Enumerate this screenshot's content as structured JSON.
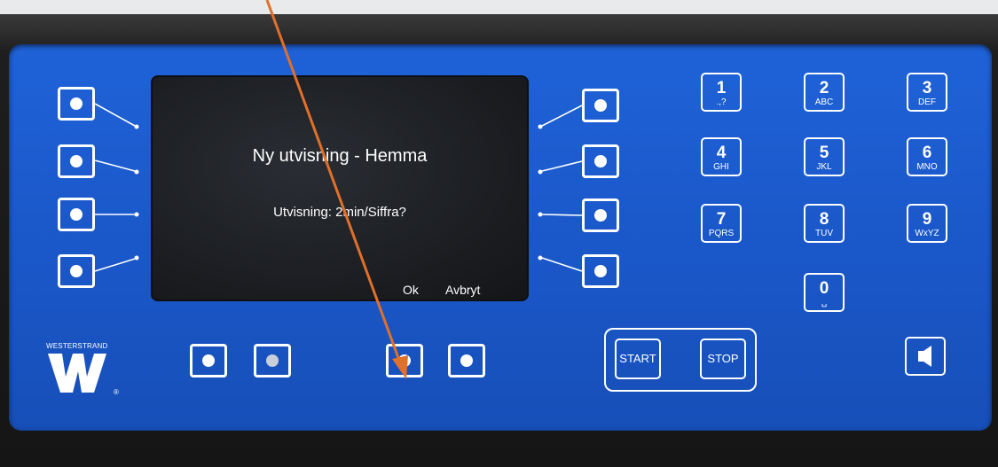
{
  "header_text": "",
  "display": {
    "title": "Ny utvisning - Hemma",
    "prompt": "Utvisning: 2min/Siffra?",
    "soft_ok": "Ok",
    "soft_cancel": "Avbryt"
  },
  "keypad": [
    {
      "num": "1",
      "letters": ".,?"
    },
    {
      "num": "2",
      "letters": "ABC"
    },
    {
      "num": "3",
      "letters": "DEF"
    },
    {
      "num": "4",
      "letters": "GHI"
    },
    {
      "num": "5",
      "letters": "JKL"
    },
    {
      "num": "6",
      "letters": "MNO"
    },
    {
      "num": "7",
      "letters": "PQRS"
    },
    {
      "num": "8",
      "letters": "TUV"
    },
    {
      "num": "9",
      "letters": "WxYZ"
    },
    {
      "num": "0",
      "letters": "␣"
    }
  ],
  "controls": {
    "start": "START",
    "stop": "STOP"
  },
  "brand": {
    "name": "WESTERSTRAND",
    "mark": "W",
    "registered": "®"
  },
  "colors": {
    "panel": "#1b59ca",
    "arrow": "#e0702a",
    "screen": "#1c1e22"
  },
  "icons": {
    "speaker": "speaker-icon",
    "soft_button_dot": "dot-icon"
  }
}
